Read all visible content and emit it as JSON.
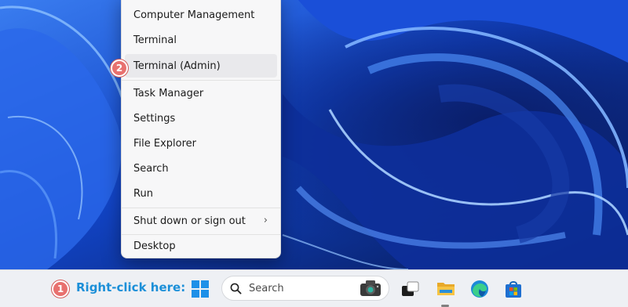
{
  "menu": {
    "items": [
      {
        "label": "Computer Management",
        "name": "menu-item-computer-management"
      },
      {
        "label": "Terminal",
        "name": "menu-item-terminal"
      },
      {
        "label": "Terminal (Admin)",
        "name": "menu-item-terminal-admin",
        "highlighted": true
      },
      {
        "label": "Task Manager",
        "name": "menu-item-task-manager"
      },
      {
        "label": "Settings",
        "name": "menu-item-settings"
      },
      {
        "label": "File Explorer",
        "name": "menu-item-file-explorer"
      },
      {
        "label": "Search",
        "name": "menu-item-search"
      },
      {
        "label": "Run",
        "name": "menu-item-run"
      },
      {
        "label": "Shut down or sign out",
        "name": "menu-item-shutdown",
        "has_submenu": true,
        "submenu_icon": "chevron-right-icon"
      },
      {
        "label": "Desktop",
        "name": "menu-item-desktop"
      }
    ]
  },
  "annotations": {
    "step1": "1",
    "step2": "2",
    "callout": "Right-click here:"
  },
  "taskbar": {
    "search_placeholder": "Search",
    "icons": [
      "windows-start-icon",
      "search-icon",
      "camera-icon",
      "task-view-icon",
      "file-explorer-icon",
      "edge-browser-icon",
      "microsoft-store-icon"
    ]
  },
  "colors": {
    "badge": "#e8716f",
    "callout_text": "#1b8fd8",
    "menu_bg": "#f7f7f8",
    "highlight": "#e9e9ec",
    "taskbar_bg": "#eef0f4",
    "windows_blue": "#1e90e8"
  }
}
